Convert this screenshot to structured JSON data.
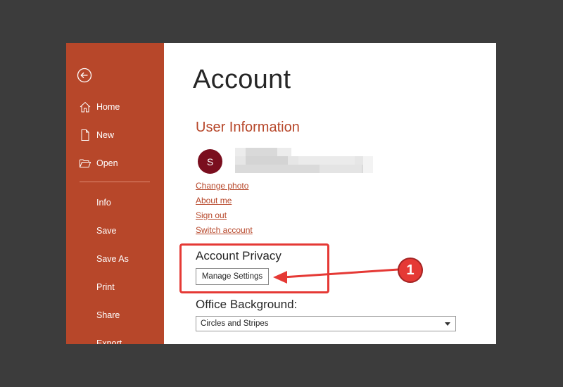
{
  "sidebar": {
    "back_icon": "back-arrow-circle-icon",
    "top_items": [
      {
        "label": "Home",
        "icon": "home-icon"
      },
      {
        "label": "New",
        "icon": "new-document-icon"
      },
      {
        "label": "Open",
        "icon": "open-folder-icon"
      }
    ],
    "items": [
      {
        "label": "Info"
      },
      {
        "label": "Save"
      },
      {
        "label": "Save As"
      },
      {
        "label": "Print"
      },
      {
        "label": "Share"
      },
      {
        "label": "Export"
      }
    ]
  },
  "main": {
    "title": "Account",
    "user_info": {
      "heading": "User Information",
      "avatar_initial": "S",
      "links": [
        "Change photo",
        "About me",
        "Sign out",
        "Switch account"
      ]
    },
    "privacy": {
      "heading": "Account Privacy",
      "button_label": "Manage Settings"
    },
    "background": {
      "heading": "Office Background:",
      "selected": "Circles and Stripes"
    }
  },
  "annotation": {
    "step_number": "1",
    "color": "#e53935"
  },
  "colors": {
    "accent": "#b7472a",
    "avatar": "#7a0e1e",
    "backdrop": "#3c3c3c"
  }
}
